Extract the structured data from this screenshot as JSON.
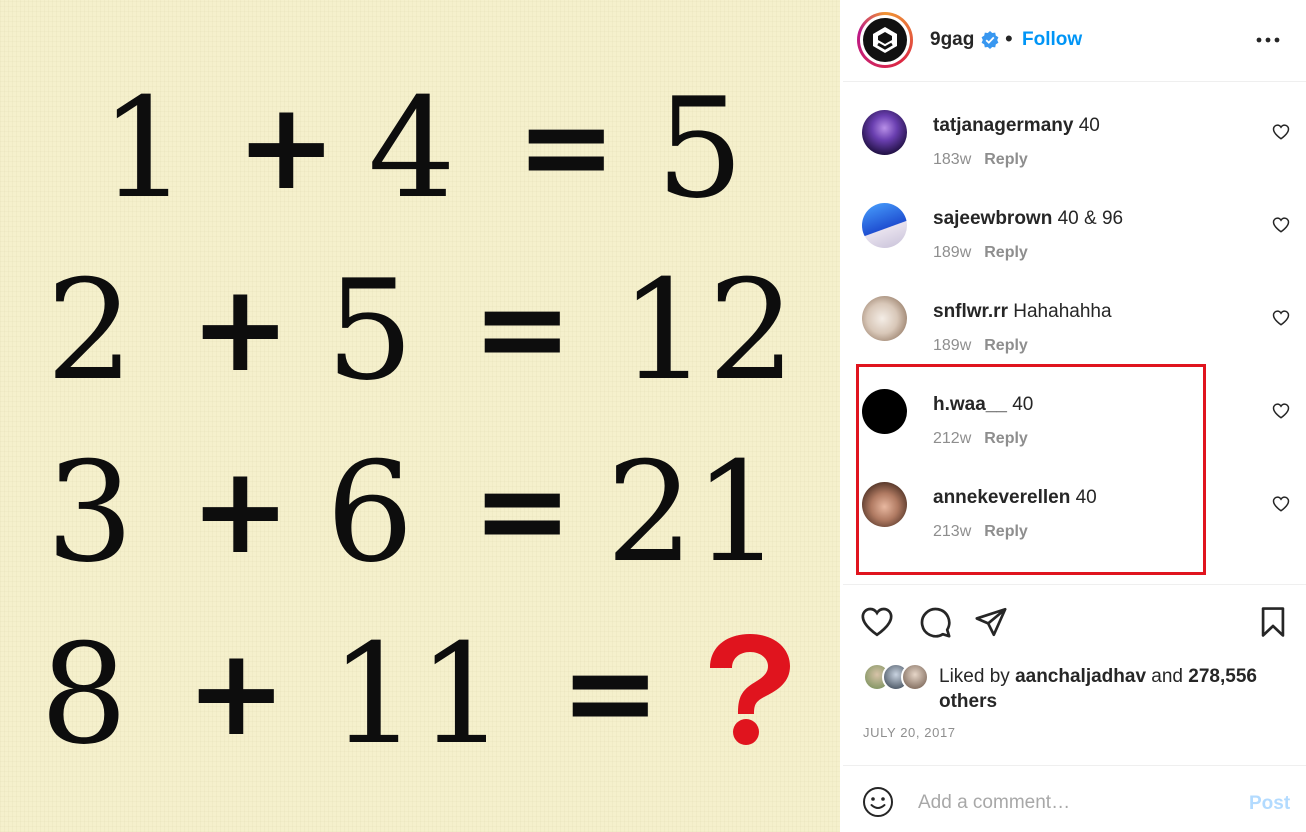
{
  "post_image": {
    "rows": [
      [
        "1",
        "+",
        "4",
        "=",
        "5"
      ],
      [
        "2",
        "+",
        "5",
        "=",
        "12"
      ],
      [
        "3",
        "+",
        "6",
        "=",
        "21"
      ],
      [
        "8",
        "+",
        "11",
        "=",
        ""
      ]
    ],
    "unknown_icon": "question-mark-icon",
    "unknown_color": "#e0141e"
  },
  "header": {
    "username": "9gag",
    "separator": "•",
    "follow_label": "Follow",
    "verified_icon": "verified-badge-icon",
    "more_icon": "more-options-icon"
  },
  "comments": [
    {
      "username": "tatjanagermany",
      "text": "40",
      "age": "183w",
      "reply_label": "Reply",
      "avatar_color": "#3a2a6e"
    },
    {
      "username": "sajeewbrown",
      "text": "40 & 96",
      "age": "189w",
      "reply_label": "Reply",
      "avatar_color": "#1f4fd1"
    },
    {
      "username": "snflwr.rr",
      "text": "Hahahahha",
      "age": "189w",
      "reply_label": "Reply",
      "avatar_color": "#c9b8a8"
    },
    {
      "username": "h.waa__",
      "text": "40",
      "age": "212w",
      "reply_label": "Reply",
      "avatar_color": "#000000"
    },
    {
      "username": "annekeverellen",
      "text": "40",
      "age": "213w",
      "reply_label": "Reply",
      "avatar_color": "#a0786a"
    }
  ],
  "highlight_color": "#e0141e",
  "actions": {
    "icons": [
      "heart-icon",
      "comment-icon",
      "share-icon",
      "bookmark-icon"
    ]
  },
  "likes": {
    "prefix": "Liked by",
    "user": "aanchaljadhav",
    "conjunction": "and",
    "count": "278,556",
    "suffix": "others"
  },
  "post_date": "JULY 20, 2017",
  "comment_bar": {
    "placeholder": "Add a comment…",
    "post_label": "Post"
  }
}
